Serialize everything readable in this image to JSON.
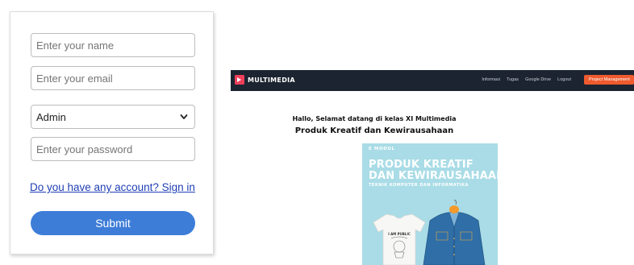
{
  "form": {
    "name_placeholder": "Enter your name",
    "email_placeholder": "Enter your email",
    "role_selected": "Admin",
    "password_placeholder": "Enter your password",
    "signin_link": "Do you have any account? Sign in",
    "submit_label": "Submit"
  },
  "site": {
    "brand": "MULTIMEDIA",
    "nav": [
      "Informasi",
      "Tugas",
      "Google Drive",
      "Logout"
    ],
    "nav_cta": "Project Management",
    "greeting": "Hallo, Selamat datang di kelas XI Multimedia",
    "subject": "Produk Kreatif dan Kewirausahaan",
    "cover": {
      "label": "E MODUL",
      "title_line1": "PRODUK KREATIF",
      "title_line2": "DAN KEWIRAUSAHAAN",
      "subtitle": "TEKNIK KOMPUTER DAN INFORMATIKA",
      "shirt_text": "I AM PUBLIC"
    }
  },
  "colors": {
    "primary_button": "#3d7dd8",
    "link": "#1f3fb5",
    "navbar": "#1c2431",
    "nav_cta": "#ef5a2e",
    "cover_bg": "#a9dce6"
  },
  "icons": {
    "select_chevron": "chevron-down-icon",
    "brand_logo": "brand-logo-icon"
  }
}
